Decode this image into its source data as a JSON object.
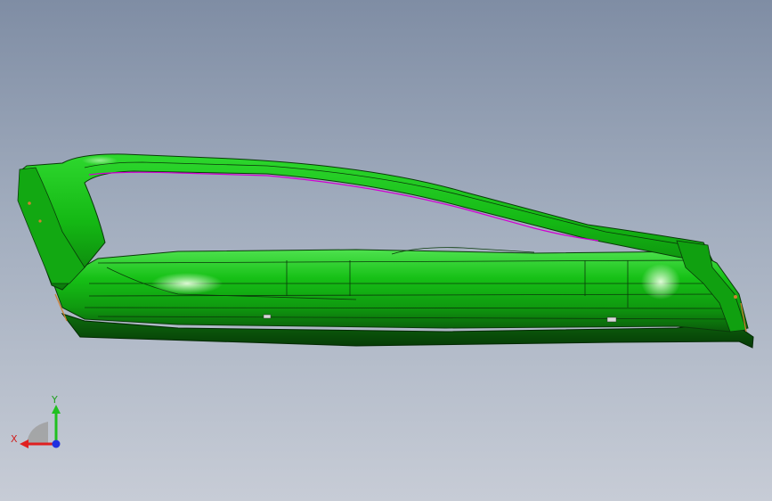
{
  "viewport": {
    "background_top": "#7f8da4",
    "background_bottom": "#c7ccd6",
    "model": {
      "name": "door-frame-model",
      "base_color": "#18c218",
      "edge_color": "#0a3a0a",
      "highlight_color": "#b6f5a8",
      "accent_color": "#d000d0"
    }
  },
  "triad": {
    "x_label": "X",
    "y_label": "Y",
    "x_color": "#e02020",
    "y_color": "#20c020",
    "z_color": "#2030e0"
  }
}
